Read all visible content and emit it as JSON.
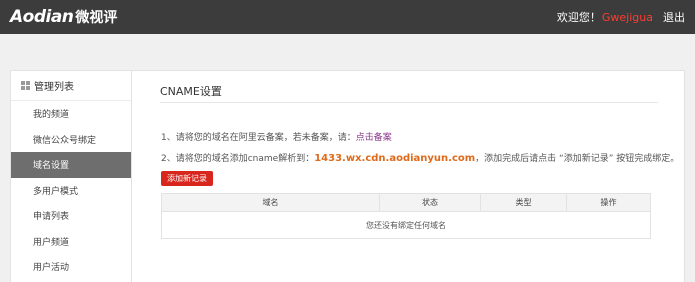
{
  "header": {
    "logo_brand": "Aodian",
    "logo_cn": "微视评",
    "welcome": "欢迎您！",
    "username": "Gwejigua",
    "logout": "退出"
  },
  "sidebar": {
    "title": "管理列表",
    "items": [
      {
        "label": "我的频道"
      },
      {
        "label": "微信公众号绑定"
      },
      {
        "label": "域名设置"
      },
      {
        "label": "多用户模式"
      },
      {
        "label": "申请列表"
      },
      {
        "label": "用户频道"
      },
      {
        "label": "用户活动"
      }
    ],
    "active": "域名设置"
  },
  "main": {
    "title": "CNAME设置",
    "step1_text": "1、请将您的域名在阿里云备案，若未备案，请：",
    "step1_link": "点击备案",
    "step2_prefix": "2、请将您的域名添加cname解析到：",
    "step2_domain": "1433.wx.cdn.aodianyun.com",
    "step2_suffix": "，添加完成后请点击 “添加新记录” 按钮完成绑定。",
    "add_button": "添加新记录",
    "table": {
      "columns": [
        "域名",
        "状态",
        "类型",
        "操作"
      ],
      "empty_text": "您还没有绑定任何域名"
    }
  },
  "colors": {
    "topbar": "#3c3c3c",
    "username": "#ff3b2f",
    "active_sidebar": "#6e6e6e",
    "button": "#d8261c",
    "domain": "#e06a1a",
    "link": "#8a3a8a"
  }
}
